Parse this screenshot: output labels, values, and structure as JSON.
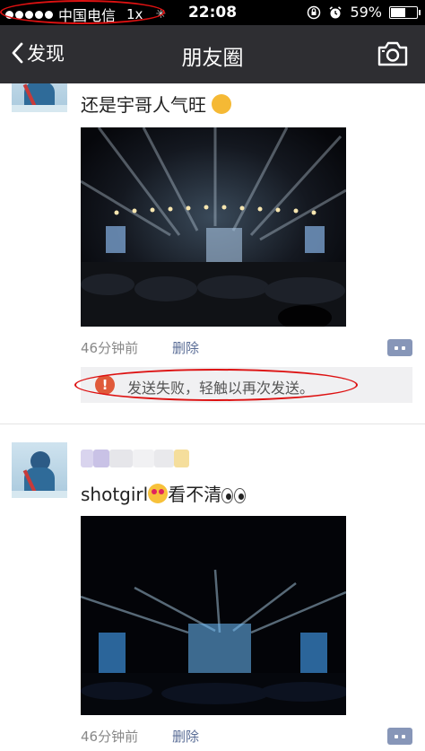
{
  "status_bar": {
    "carrier": "中国电信",
    "network": "1x",
    "time": "22:08",
    "battery": "59%",
    "battery_level": 0.59
  },
  "nav": {
    "back_label": "发现",
    "title": "朋友圈"
  },
  "posts": [
    {
      "text": "还是宇哥人气旺",
      "time": "46分钟前",
      "delete_label": "删除",
      "send_failed": "发送失败，轻触以再次发送。"
    },
    {
      "text_prefix": "shotgirl",
      "text_suffix": "看不清",
      "time": "46分钟前",
      "delete_label": "删除"
    }
  ],
  "colors": {
    "nav_bg": "#2e2e32",
    "link": "#5a6d96",
    "annotation_red": "#d11111",
    "fail_icon": "#e05a3a"
  },
  "icons": [
    "chevron-left-icon",
    "camera-icon",
    "comment-icon",
    "warning-icon",
    "alarm-icon",
    "rotation-lock-icon"
  ]
}
